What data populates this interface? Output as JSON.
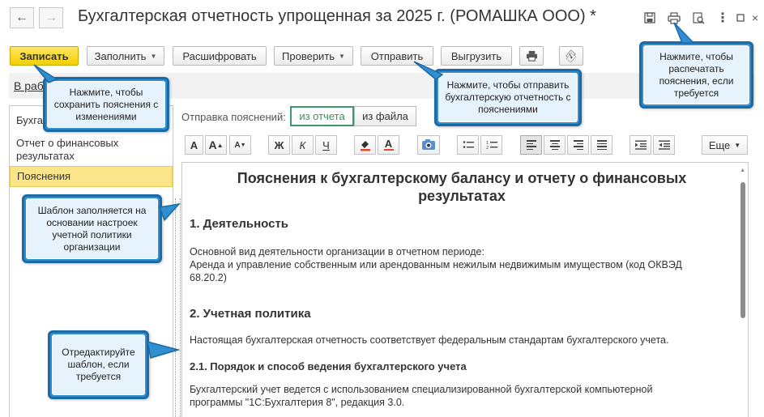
{
  "window": {
    "title": "Бухгалтерская отчетность упрощенная за 2025 г. (РОМАШКА ООО) *"
  },
  "toolbar": {
    "save_label": "Записать",
    "fill_label": "Заполнить",
    "decode_label": "Расшифровать",
    "check_label": "Проверить",
    "send_label": "Отправить",
    "export_label": "Выгрузить"
  },
  "breadcrumb": {
    "label": "В раб"
  },
  "sidebar": {
    "items": [
      {
        "label": "Бухга"
      },
      {
        "label": "Отчет о финансовых результатах"
      },
      {
        "label": "Пояснения"
      }
    ]
  },
  "send_explanations": {
    "label": "Отправка пояснений:",
    "options": [
      "из отчета",
      "из файла"
    ],
    "selected": "из отчета"
  },
  "format_toolbar": {
    "font_a": "A",
    "font_a_up": "A",
    "font_a_down": "A",
    "bold": "Ж",
    "italic": "К",
    "underline": "Ч",
    "text_color": "A",
    "more_label": "Еще"
  },
  "document": {
    "title_line1": "Пояснения к бухгалтерскому балансу и отчету о финансовых",
    "title_line2": "результатах",
    "s1_heading": "1. Деятельность",
    "s1_p1": "Основной вид деятельности организации в отчетном периоде:",
    "s1_p2": "Аренда и управление собственным или арендованным нежилым недвижимым имуществом (код ОКВЭД",
    "s1_p3": "68.20.2)",
    "s2_heading": "2. Учетная политика",
    "s2_p1": "Настоящая бухгалтерская отчетность соответствует федеральным стандартам бухгалтерского учета.",
    "s21_heading": "2.1. Порядок и способ ведения бухгалтерского учета",
    "s21_p1": "Бухгалтерский учет ведется с использованием специализированной бухгалтерской компьютерной",
    "s21_p2": "программы \"1С:Бухгалтерия 8\", редакция 3.0."
  },
  "callouts": {
    "save": "Нажмите, чтобы сохранить пояснения с изменениями",
    "send": "Нажмите, чтобы отправить бухгалтерскую отчетность с пояснениями",
    "print": "Нажмите, чтобы распечатать пояснения, если требуется",
    "template": "Шаблон заполняется на основании настроек учетной политики организации",
    "edit": "Отредактируйте шаблон, если требуется"
  },
  "colors": {
    "primary_button": "#f3d000",
    "callout_border": "#1b6aa4",
    "callout_fill": "#e6f3fc",
    "active_sidebar": "#fbe58a",
    "selected_toggle": "#3b9a68"
  },
  "icons": [
    "back-arrow-icon",
    "forward-arrow-icon",
    "save-disk-icon",
    "print-icon",
    "preview-icon",
    "more-vertical-icon",
    "maximize-icon",
    "close-icon",
    "paperclip-icon",
    "fill-color-icon",
    "insert-image-icon",
    "bullet-list-icon",
    "numbered-list-icon",
    "align-left-icon",
    "align-center-icon",
    "align-right-icon",
    "align-justify-icon",
    "indent-increase-icon",
    "indent-decrease-icon"
  ]
}
